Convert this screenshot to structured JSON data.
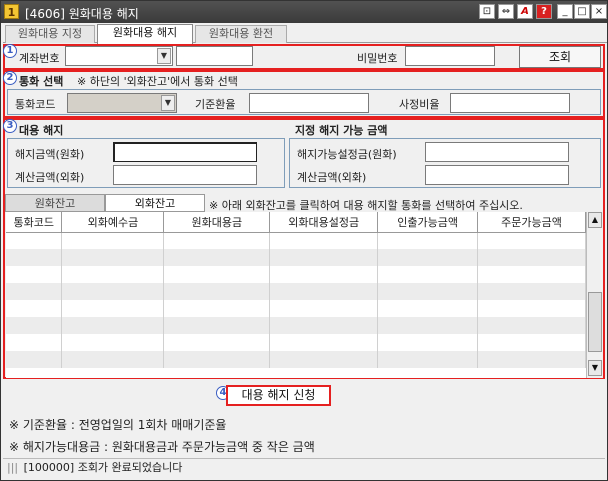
{
  "window": {
    "title": "[4606] 원화대용 해지",
    "app_icon_glyph": "1",
    "controls": [
      "⊡",
      "⇔",
      "A",
      "?",
      "_",
      "□",
      "×"
    ]
  },
  "tabs": [
    {
      "label": "원화대용 지정",
      "active": false
    },
    {
      "label": "원화대용 해지",
      "active": true
    },
    {
      "label": "원화대용 환전",
      "active": false
    }
  ],
  "section1": {
    "marker": "1",
    "account_label": "계좌번호",
    "account_value": "",
    "account_name_value": "",
    "password_label": "비밀번호",
    "password_value": "",
    "query_button": "조회"
  },
  "section2": {
    "marker": "2",
    "title": "통화 선택",
    "hint": "※ 하단의 '외화잔고'에서 통화 선택",
    "currency_code_label": "통화코드",
    "currency_code_value": "",
    "base_rate_label": "기준환율",
    "base_rate_value": "",
    "apply_ratio_label": "사정비율",
    "apply_ratio_value": ""
  },
  "section3": {
    "marker": "3",
    "left": {
      "title": "대용 해지",
      "cancel_amount_label": "해지금액(원화)",
      "cancel_amount_value": "",
      "calc_amount_label": "계산금액(외화)",
      "calc_amount_value": ""
    },
    "right": {
      "title": "지정 해지 가능 금액",
      "available_label": "해지가능설정금(원화)",
      "available_value": "",
      "calc_amount_label": "계산금액(외화)",
      "calc_amount_value": ""
    },
    "balance_tabs": [
      "원화잔고",
      "외화잔고"
    ],
    "balance_hint": "※ 아래 외화잔고를 클릭하여 대용 해지할 통화를 선택하여 주십시오.",
    "grid_columns": [
      "통화코드",
      "외화예수금",
      "원화대용금",
      "외화대용설정금",
      "인출가능금액",
      "주문가능금액"
    ],
    "grid_rows": 9
  },
  "submit": {
    "marker": "4",
    "label": "대용 해지 신청"
  },
  "notes": [
    "※ 기준환율 : 전영업일의 1회차 매매기준율",
    "※ 해지가능대용금 : 원화대용금과 주문가능금액 중 작은 금액"
  ],
  "status": {
    "text": "[100000] 조회가 완료되었습니다"
  }
}
